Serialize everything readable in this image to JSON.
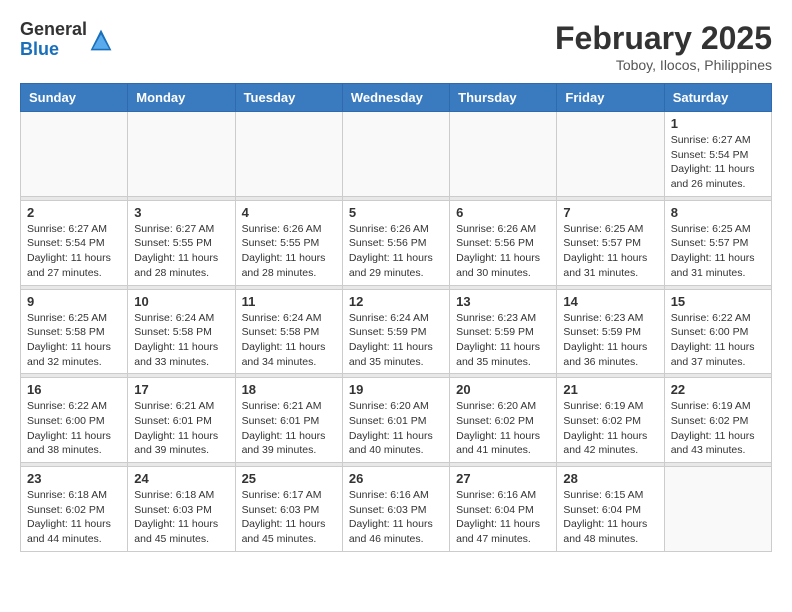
{
  "logo": {
    "general": "General",
    "blue": "Blue"
  },
  "title": "February 2025",
  "location": "Toboy, Ilocos, Philippines",
  "days_of_week": [
    "Sunday",
    "Monday",
    "Tuesday",
    "Wednesday",
    "Thursday",
    "Friday",
    "Saturday"
  ],
  "weeks": [
    [
      {
        "day": "",
        "info": ""
      },
      {
        "day": "",
        "info": ""
      },
      {
        "day": "",
        "info": ""
      },
      {
        "day": "",
        "info": ""
      },
      {
        "day": "",
        "info": ""
      },
      {
        "day": "",
        "info": ""
      },
      {
        "day": "1",
        "info": "Sunrise: 6:27 AM\nSunset: 5:54 PM\nDaylight: 11 hours\nand 26 minutes."
      }
    ],
    [
      {
        "day": "2",
        "info": "Sunrise: 6:27 AM\nSunset: 5:54 PM\nDaylight: 11 hours\nand 27 minutes."
      },
      {
        "day": "3",
        "info": "Sunrise: 6:27 AM\nSunset: 5:55 PM\nDaylight: 11 hours\nand 28 minutes."
      },
      {
        "day": "4",
        "info": "Sunrise: 6:26 AM\nSunset: 5:55 PM\nDaylight: 11 hours\nand 28 minutes."
      },
      {
        "day": "5",
        "info": "Sunrise: 6:26 AM\nSunset: 5:56 PM\nDaylight: 11 hours\nand 29 minutes."
      },
      {
        "day": "6",
        "info": "Sunrise: 6:26 AM\nSunset: 5:56 PM\nDaylight: 11 hours\nand 30 minutes."
      },
      {
        "day": "7",
        "info": "Sunrise: 6:25 AM\nSunset: 5:57 PM\nDaylight: 11 hours\nand 31 minutes."
      },
      {
        "day": "8",
        "info": "Sunrise: 6:25 AM\nSunset: 5:57 PM\nDaylight: 11 hours\nand 31 minutes."
      }
    ],
    [
      {
        "day": "9",
        "info": "Sunrise: 6:25 AM\nSunset: 5:58 PM\nDaylight: 11 hours\nand 32 minutes."
      },
      {
        "day": "10",
        "info": "Sunrise: 6:24 AM\nSunset: 5:58 PM\nDaylight: 11 hours\nand 33 minutes."
      },
      {
        "day": "11",
        "info": "Sunrise: 6:24 AM\nSunset: 5:58 PM\nDaylight: 11 hours\nand 34 minutes."
      },
      {
        "day": "12",
        "info": "Sunrise: 6:24 AM\nSunset: 5:59 PM\nDaylight: 11 hours\nand 35 minutes."
      },
      {
        "day": "13",
        "info": "Sunrise: 6:23 AM\nSunset: 5:59 PM\nDaylight: 11 hours\nand 35 minutes."
      },
      {
        "day": "14",
        "info": "Sunrise: 6:23 AM\nSunset: 5:59 PM\nDaylight: 11 hours\nand 36 minutes."
      },
      {
        "day": "15",
        "info": "Sunrise: 6:22 AM\nSunset: 6:00 PM\nDaylight: 11 hours\nand 37 minutes."
      }
    ],
    [
      {
        "day": "16",
        "info": "Sunrise: 6:22 AM\nSunset: 6:00 PM\nDaylight: 11 hours\nand 38 minutes."
      },
      {
        "day": "17",
        "info": "Sunrise: 6:21 AM\nSunset: 6:01 PM\nDaylight: 11 hours\nand 39 minutes."
      },
      {
        "day": "18",
        "info": "Sunrise: 6:21 AM\nSunset: 6:01 PM\nDaylight: 11 hours\nand 39 minutes."
      },
      {
        "day": "19",
        "info": "Sunrise: 6:20 AM\nSunset: 6:01 PM\nDaylight: 11 hours\nand 40 minutes."
      },
      {
        "day": "20",
        "info": "Sunrise: 6:20 AM\nSunset: 6:02 PM\nDaylight: 11 hours\nand 41 minutes."
      },
      {
        "day": "21",
        "info": "Sunrise: 6:19 AM\nSunset: 6:02 PM\nDaylight: 11 hours\nand 42 minutes."
      },
      {
        "day": "22",
        "info": "Sunrise: 6:19 AM\nSunset: 6:02 PM\nDaylight: 11 hours\nand 43 minutes."
      }
    ],
    [
      {
        "day": "23",
        "info": "Sunrise: 6:18 AM\nSunset: 6:02 PM\nDaylight: 11 hours\nand 44 minutes."
      },
      {
        "day": "24",
        "info": "Sunrise: 6:18 AM\nSunset: 6:03 PM\nDaylight: 11 hours\nand 45 minutes."
      },
      {
        "day": "25",
        "info": "Sunrise: 6:17 AM\nSunset: 6:03 PM\nDaylight: 11 hours\nand 45 minutes."
      },
      {
        "day": "26",
        "info": "Sunrise: 6:16 AM\nSunset: 6:03 PM\nDaylight: 11 hours\nand 46 minutes."
      },
      {
        "day": "27",
        "info": "Sunrise: 6:16 AM\nSunset: 6:04 PM\nDaylight: 11 hours\nand 47 minutes."
      },
      {
        "day": "28",
        "info": "Sunrise: 6:15 AM\nSunset: 6:04 PM\nDaylight: 11 hours\nand 48 minutes."
      },
      {
        "day": "",
        "info": ""
      }
    ]
  ]
}
